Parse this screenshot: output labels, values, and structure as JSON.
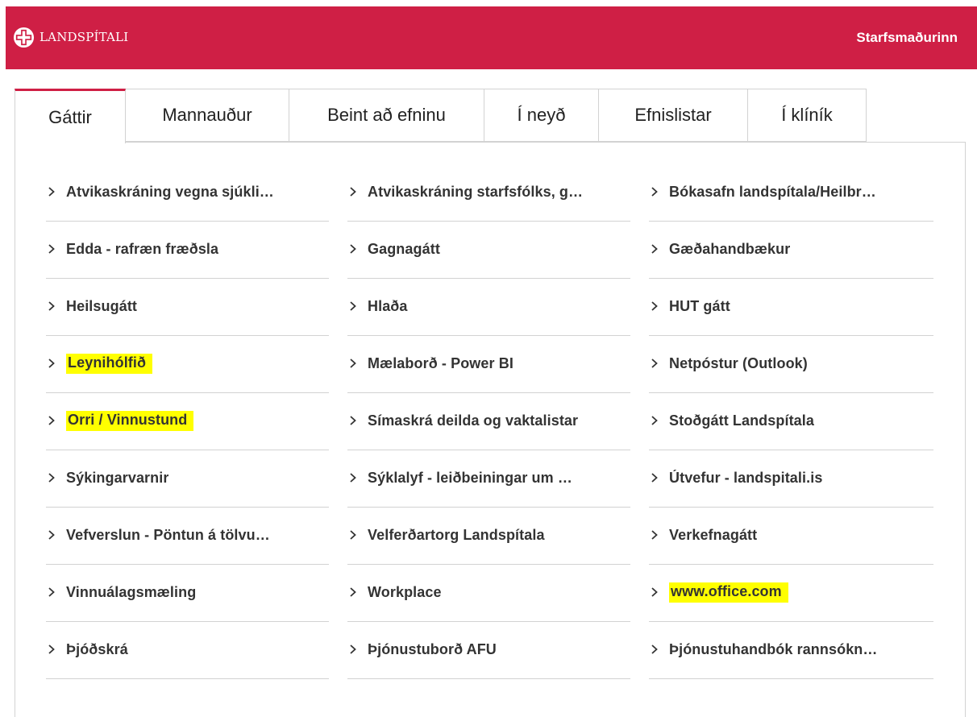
{
  "colors": {
    "brand": "#cf1f45",
    "highlight": "#ffff00"
  },
  "header": {
    "logo_text": "LANDSPÍTALI",
    "logo_icon": "cross-logo-icon",
    "user_link": "Starfsmaðurinn"
  },
  "tabs": [
    {
      "label": "Gáttir",
      "active": true
    },
    {
      "label": "Mannauður",
      "active": false
    },
    {
      "label": "Beint að efninu",
      "active": false
    },
    {
      "label": "Í neyð",
      "active": false
    },
    {
      "label": "Efnislistar",
      "active": false
    },
    {
      "label": "Í klíník",
      "active": false
    }
  ],
  "links": {
    "col1": [
      {
        "label": "Atvikaskráning vegna sjúkli…",
        "highlighted": false
      },
      {
        "label": "Edda - rafræn fræðsla",
        "highlighted": false
      },
      {
        "label": "Heilsugátt",
        "highlighted": false
      },
      {
        "label": "Leynihólfið",
        "highlighted": true
      },
      {
        "label": "Orri / Vinnustund",
        "highlighted": true
      },
      {
        "label": "Sýkingarvarnir",
        "highlighted": false
      },
      {
        "label": "Vefverslun - Pöntun á tölvu…",
        "highlighted": false
      },
      {
        "label": "Vinnuálagsmæling",
        "highlighted": false
      },
      {
        "label": "Þjóðskrá",
        "highlighted": false
      }
    ],
    "col2": [
      {
        "label": "Atvikaskráning starfsfólks, g…",
        "highlighted": false
      },
      {
        "label": "Gagnagátt",
        "highlighted": false
      },
      {
        "label": "Hlaða",
        "highlighted": false
      },
      {
        "label": "Mælaborð - Power BI",
        "highlighted": false
      },
      {
        "label": "Símaskrá deilda og vaktalistar",
        "highlighted": false
      },
      {
        "label": "Sýklalyf - leiðbeiningar um …",
        "highlighted": false
      },
      {
        "label": "Velferðartorg Landspítala",
        "highlighted": false
      },
      {
        "label": "Workplace",
        "highlighted": false
      },
      {
        "label": "Þjónustuborð AFU",
        "highlighted": false
      }
    ],
    "col3": [
      {
        "label": "Bókasafn landspítala/Heilbr…",
        "highlighted": false
      },
      {
        "label": "Gæðahandbækur",
        "highlighted": false
      },
      {
        "label": "HUT gátt",
        "highlighted": false
      },
      {
        "label": "Netpóstur (Outlook)",
        "highlighted": false
      },
      {
        "label": "Stoðgátt Landspítala",
        "highlighted": false
      },
      {
        "label": "Útvefur - landspitali.is",
        "highlighted": false
      },
      {
        "label": "Verkefnagátt",
        "highlighted": false
      },
      {
        "label": "www.office.com",
        "highlighted": true
      },
      {
        "label": "Þjónustuhandbók rannsókn…",
        "highlighted": false
      }
    ]
  }
}
